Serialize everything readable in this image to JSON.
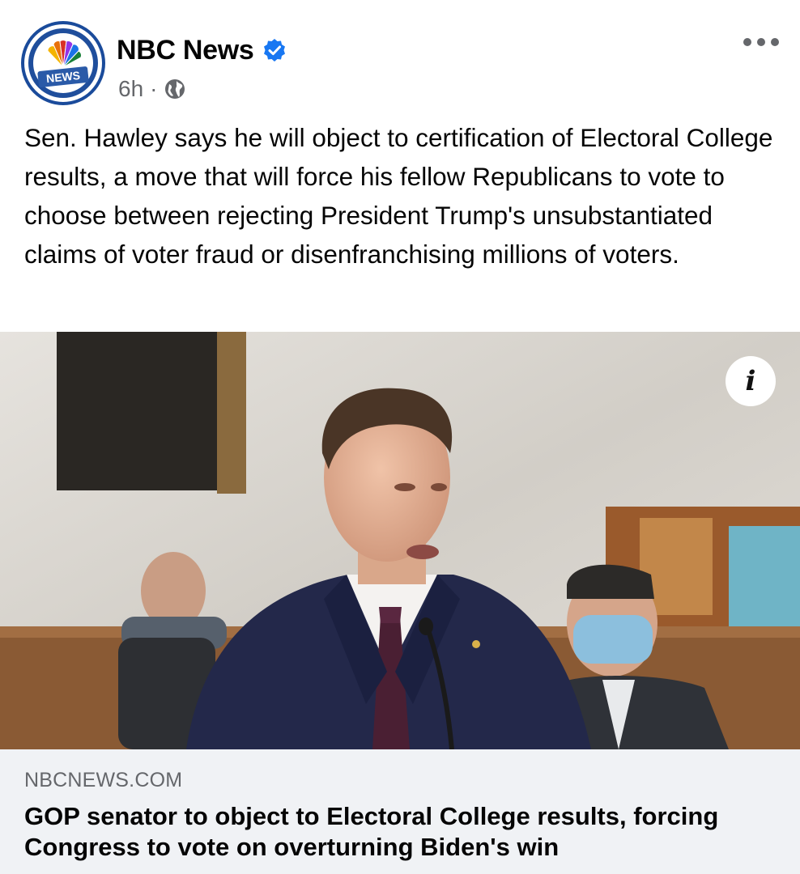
{
  "post": {
    "page_name": "NBC News",
    "verified": true,
    "timestamp": "6h",
    "separator": "·",
    "audience_icon": "globe-icon",
    "avatar_badge": "NEWS",
    "more_icon": "more-options-icon",
    "text": "Sen. Hawley says he will object to certification of Electoral College results, a move that will force his fellow Republicans to vote to choose between rejecting President Trump's unsubstantiated claims of voter fraud or disenfranchising millions of voters.",
    "image_info_label": "i",
    "link": {
      "domain": "NBCNEWS.COM",
      "title": "GOP senator to object to Electoral College results, forcing Congress to vote on overturning Biden's win"
    }
  },
  "colors": {
    "verified_blue": "#1877f2",
    "secondary_text": "#65676b",
    "link_background": "#f0f2f5",
    "nbc_blue": "#1f4e9c"
  }
}
